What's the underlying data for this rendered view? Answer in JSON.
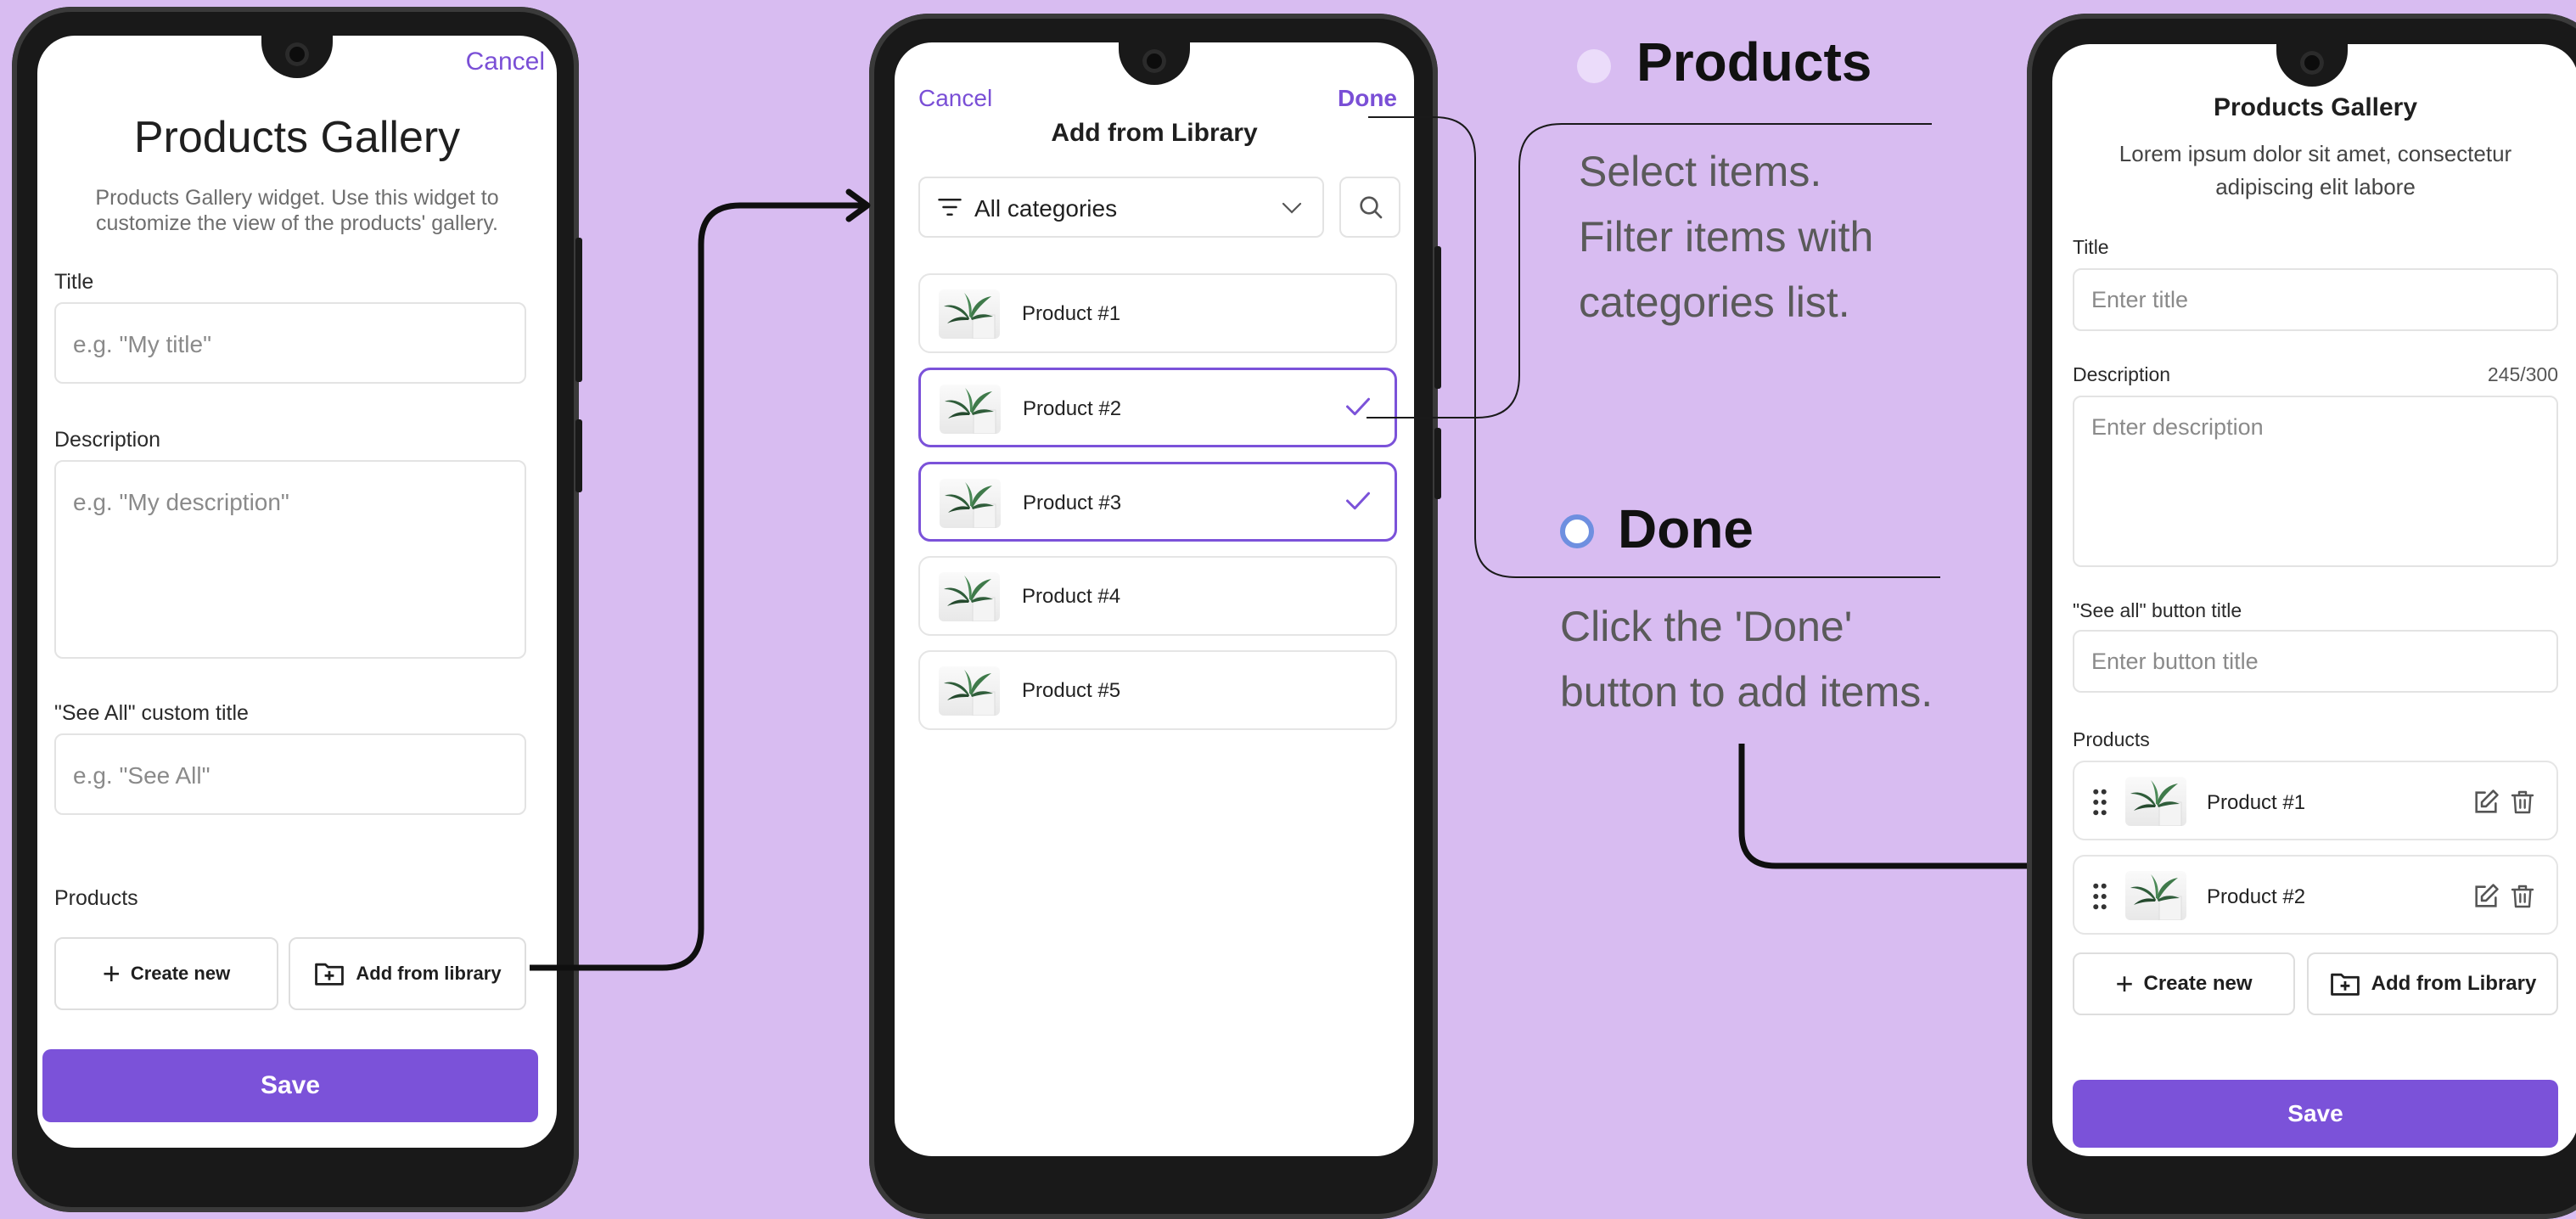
{
  "phone1": {
    "cancel": "Cancel",
    "title": "Products Gallery",
    "description": "Products Gallery widget. Use this widget to customize the view of the products' gallery.",
    "title_label": "Title",
    "title_placeholder": "e.g. \"My title\"",
    "description_label": "Description",
    "description_placeholder": "e.g. \"My description\"",
    "see_all_label": "\"See All\" custom title",
    "see_all_placeholder": "e.g. \"See All\"",
    "products_label": "Products",
    "create_new": "Create new",
    "add_from_library": "Add from library",
    "save": "Save"
  },
  "phone2": {
    "cancel": "Cancel",
    "done": "Done",
    "title": "Add from Library",
    "category_select": "All categories",
    "products": [
      {
        "name": "Product #1",
        "selected": false
      },
      {
        "name": "Product #2",
        "selected": true
      },
      {
        "name": "Product #3",
        "selected": true
      },
      {
        "name": "Product #4",
        "selected": false
      },
      {
        "name": "Product #5",
        "selected": false
      }
    ]
  },
  "annotations": {
    "products_title": "Products",
    "products_text": [
      "Select items.",
      "Filter items with",
      "categories list."
    ],
    "done_title": "Done",
    "done_text": [
      "Click the 'Done'",
      "button to add items."
    ]
  },
  "phone3": {
    "title": "Products Gallery",
    "description": "Lorem ipsum dolor sit amet, consectetur adipiscing elit labore",
    "title_label": "Title",
    "title_placeholder": "Enter title",
    "description_label": "Description",
    "description_counter": "245/300",
    "description_placeholder": "Enter description",
    "see_all_label": "\"See all\" button title",
    "see_all_placeholder": "Enter button title",
    "products_label": "Products",
    "products": [
      {
        "name": "Product #1"
      },
      {
        "name": "Product #2"
      }
    ],
    "create_new": "Create new",
    "add_from_library": "Add from Library",
    "save": "Save"
  },
  "colors": {
    "background": "#d8bcf1",
    "accent": "#7b52d9",
    "phone_frame": "#191919"
  },
  "icons": [
    "plus-icon",
    "folder-plus-icon",
    "filter-icon",
    "chevron-down-icon",
    "search-icon",
    "check-icon",
    "drag-handle-icon",
    "edit-icon",
    "trash-icon",
    "plant-image"
  ]
}
